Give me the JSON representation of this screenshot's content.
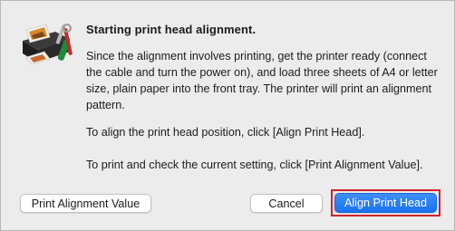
{
  "dialog": {
    "title": "Starting print head alignment.",
    "paragraph1": "Since the alignment involves printing, get the printer ready (connect the cable and turn the power on), and load three sheets of A4 or letter size, plain paper into the front tray. The printer will print an alignment pattern.",
    "paragraph2": "To align the print head position, click [Align Print Head].",
    "paragraph3": "To print and check the current setting, click [Print Alignment Value]."
  },
  "buttons": {
    "print_alignment_value": "Print Alignment Value",
    "cancel": "Cancel",
    "align_print_head": "Align Print Head"
  },
  "colors": {
    "primary_button": "#1a72f1",
    "highlight_border": "#d0202a"
  }
}
